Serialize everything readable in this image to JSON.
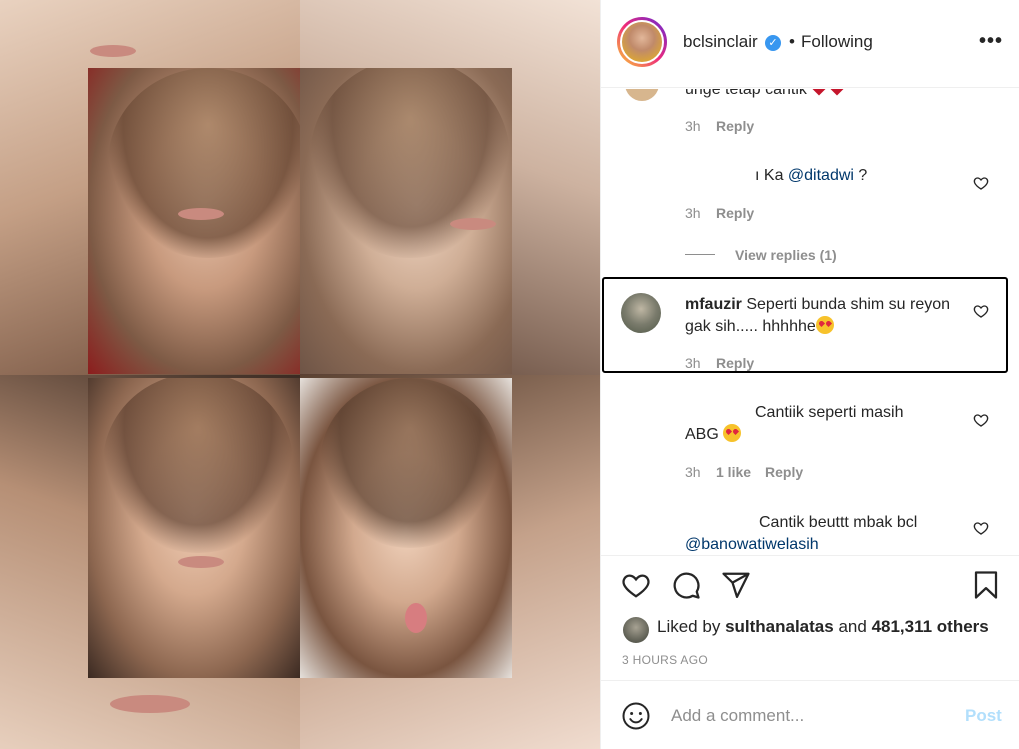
{
  "header": {
    "username": "bclsinclair",
    "verified_glyph": "✓",
    "separator": "•",
    "follow_status": "Following",
    "more_glyph": "•••"
  },
  "comments": [
    {
      "text": "unge tetap cantik",
      "time": "3h",
      "reply_label": "Reply"
    },
    {
      "text_prefix": "ı Ka ",
      "mention": "@ditadwi",
      "text_suffix": " ?",
      "time": "3h",
      "reply_label": "Reply",
      "view_replies": "View replies (1)"
    },
    {
      "username": "mfauzir",
      "text": "Seperti bunda shim su reyon gak sih..... hhhhhe",
      "time": "3h",
      "reply_label": "Reply"
    },
    {
      "text_line1": "Cantiik seperti masih",
      "text_line2": "ABG",
      "time": "3h",
      "likes": "1 like",
      "reply_label": "Reply"
    },
    {
      "text": "Cantik beuttt mbak bcl",
      "mention": "@banowatiwelasih"
    }
  ],
  "likes": {
    "prefix": "Liked by",
    "user": "sulthanalatas",
    "and": "and",
    "count": "481,311 others"
  },
  "timestamp": "3 HOURS AGO",
  "add_comment": {
    "placeholder": "Add a comment...",
    "post_label": "Post"
  },
  "colors": {
    "verified": "#3897f0",
    "mention": "#00376b",
    "post_disabled": "#b2dffc",
    "meta_gray": "#8e8e8e"
  },
  "icons": [
    "verified-badge-icon",
    "more-options-icon",
    "heart-icon",
    "comment-icon",
    "share-icon",
    "bookmark-icon",
    "emoji-icon"
  ]
}
